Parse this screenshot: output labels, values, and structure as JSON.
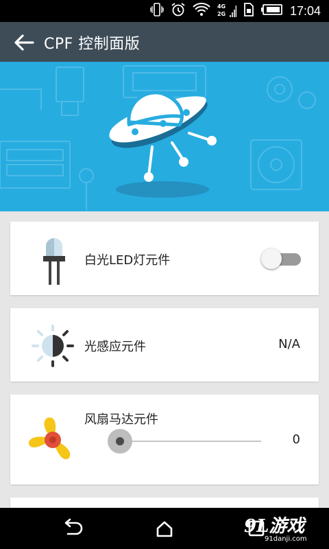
{
  "status_bar": {
    "time": "17:04",
    "network_labels": [
      "4G",
      "2G"
    ],
    "icons": [
      "vibrate-icon",
      "alarm-icon",
      "wifi-icon",
      "signal-icon",
      "sim-icon",
      "battery-icon"
    ]
  },
  "app_bar": {
    "title": "CPF 控制面版",
    "back_icon": "arrow-back-icon"
  },
  "hero": {
    "background_color": "#27ace0",
    "main_icon": "ufo-icon"
  },
  "components": [
    {
      "label": "白光LED灯元件",
      "icon": "led-icon",
      "control": "toggle",
      "toggle_on": false
    },
    {
      "label": "光感应元件",
      "icon": "light-sensor-icon",
      "control": "value",
      "value": "N/A"
    },
    {
      "label": "风扇马达元件",
      "icon": "fan-icon",
      "control": "slider",
      "slider_value": 0,
      "value": "0"
    }
  ],
  "nav_bar": {
    "buttons": [
      "back-nav-icon",
      "home-nav-icon",
      "recents-nav-icon"
    ]
  },
  "watermark": {
    "big": "9L游戏",
    "small": "91danji.com"
  },
  "colors": {
    "app_bar": "#3d4c57",
    "hero": "#27ace0",
    "fan_yellow": "#f5c518",
    "fan_center": "#e0503a"
  }
}
